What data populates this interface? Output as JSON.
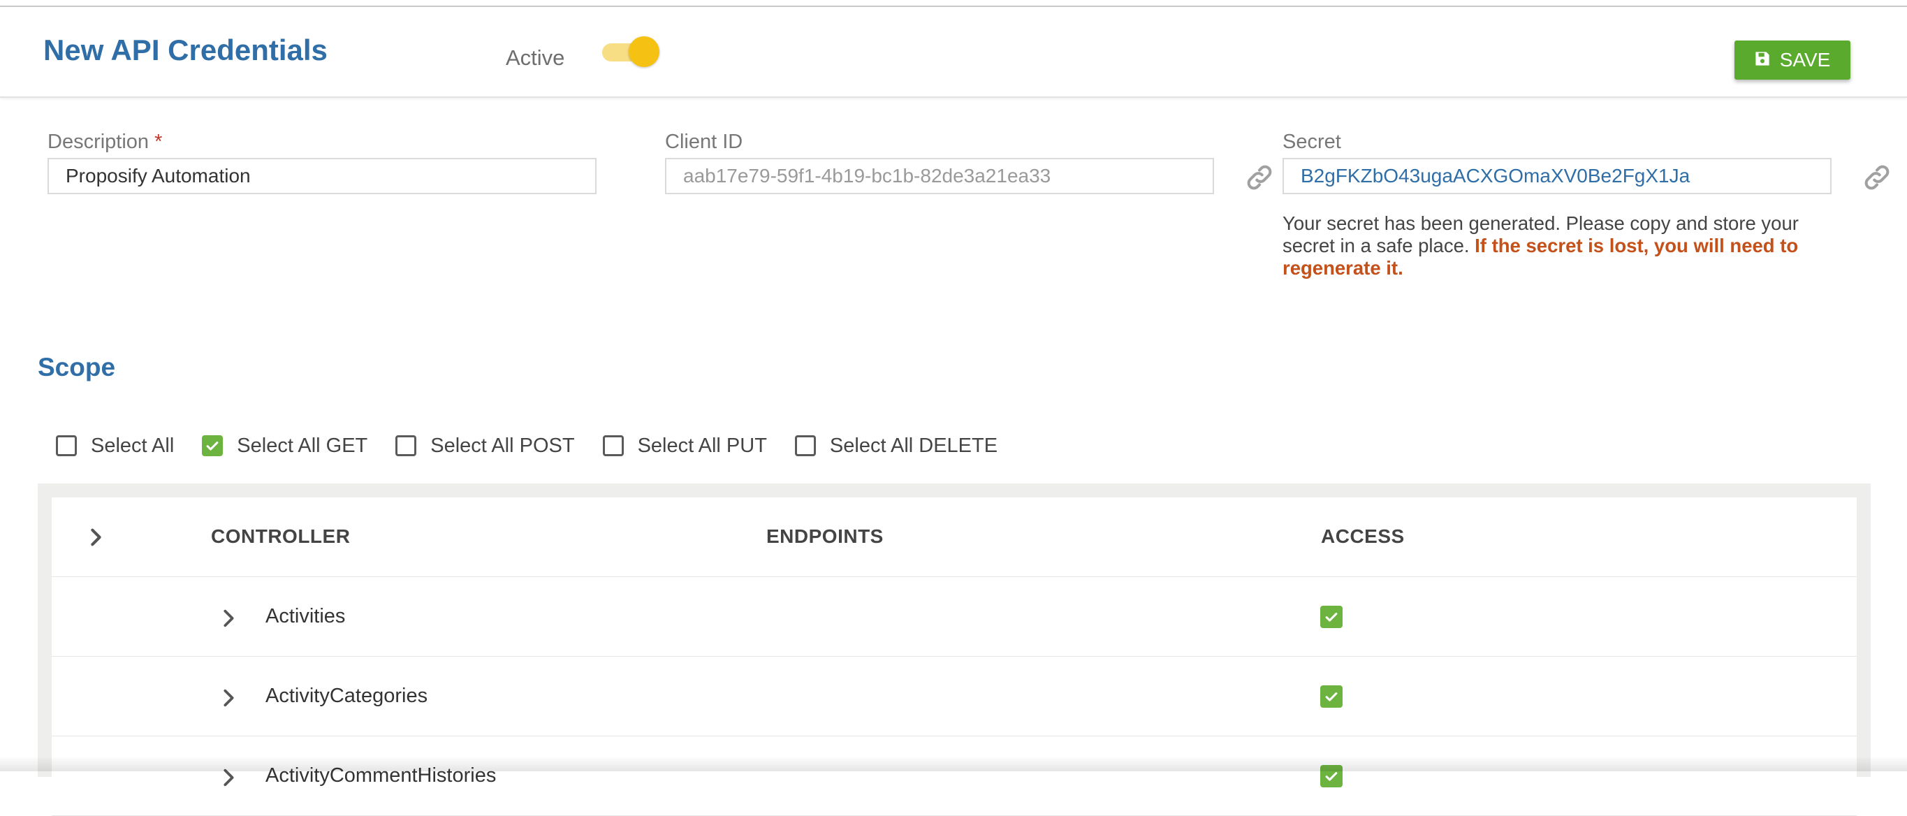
{
  "header": {
    "title": "New API Credentials",
    "active_label": "Active",
    "active_on": true,
    "save_label": "SAVE"
  },
  "form": {
    "description": {
      "label": "Description",
      "required_mark": "*",
      "value": "Proposify Automation"
    },
    "client_id": {
      "label": "Client ID",
      "value": "aab17e79-59f1-4b19-bc1b-82de3a21ea33"
    },
    "secret": {
      "label": "Secret",
      "value": "B2gFKZbO43ugaACXGOmaXV0Be2FgX1Ja",
      "note": "Your secret has been generated. Please copy and store your secret in a safe place. ",
      "warning": "If the secret is lost, you will need to regenerate it."
    }
  },
  "scope": {
    "heading": "Scope",
    "select_options": [
      {
        "label": "Select All",
        "checked": false
      },
      {
        "label": "Select All GET",
        "checked": true
      },
      {
        "label": "Select All POST",
        "checked": false
      },
      {
        "label": "Select All PUT",
        "checked": false
      },
      {
        "label": "Select All DELETE",
        "checked": false
      }
    ]
  },
  "table": {
    "columns": {
      "controller": "CONTROLLER",
      "endpoints": "ENDPOINTS",
      "access": "ACCESS"
    },
    "rows": [
      {
        "controller": "Activities",
        "access": true
      },
      {
        "controller": "ActivityCategories",
        "access": true
      },
      {
        "controller": "ActivityCommentHistories",
        "access": true
      }
    ]
  },
  "colors": {
    "accent_blue": "#2f6ea7",
    "save_green": "#5aaa2e",
    "check_green": "#6cb33f",
    "toggle_yellow": "#f5c214",
    "warning_orange": "#c4501a"
  },
  "icons": {
    "save": "floppy-disk-icon",
    "copy_link": "link-icon",
    "expand": "chevron-right-icon",
    "check": "checkmark-icon"
  }
}
